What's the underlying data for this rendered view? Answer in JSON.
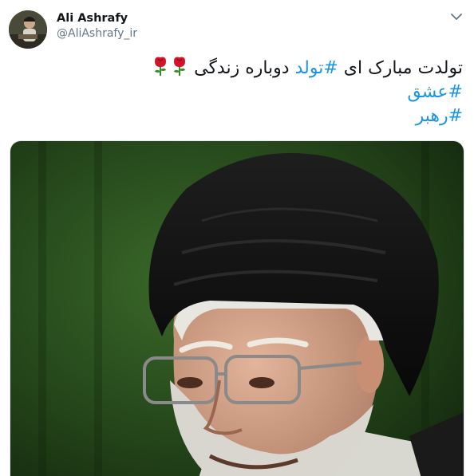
{
  "user": {
    "display_name": "Ali Ashrafy",
    "handle": "@AliAshrafy_ir"
  },
  "tweet": {
    "line1_before": "تولدت مبارک ای ",
    "line1_hashtag": "#تولد",
    "line1_after": " دوباره زندگی",
    "line2_hashtag": "#عشق",
    "line3_hashtag": "#رهبر"
  },
  "icons": {
    "menu": "chevron-down-icon",
    "emoji": "rose-icon"
  },
  "colors": {
    "link": "#1b95e0",
    "text": "#14171a",
    "secondary": "#657786"
  }
}
